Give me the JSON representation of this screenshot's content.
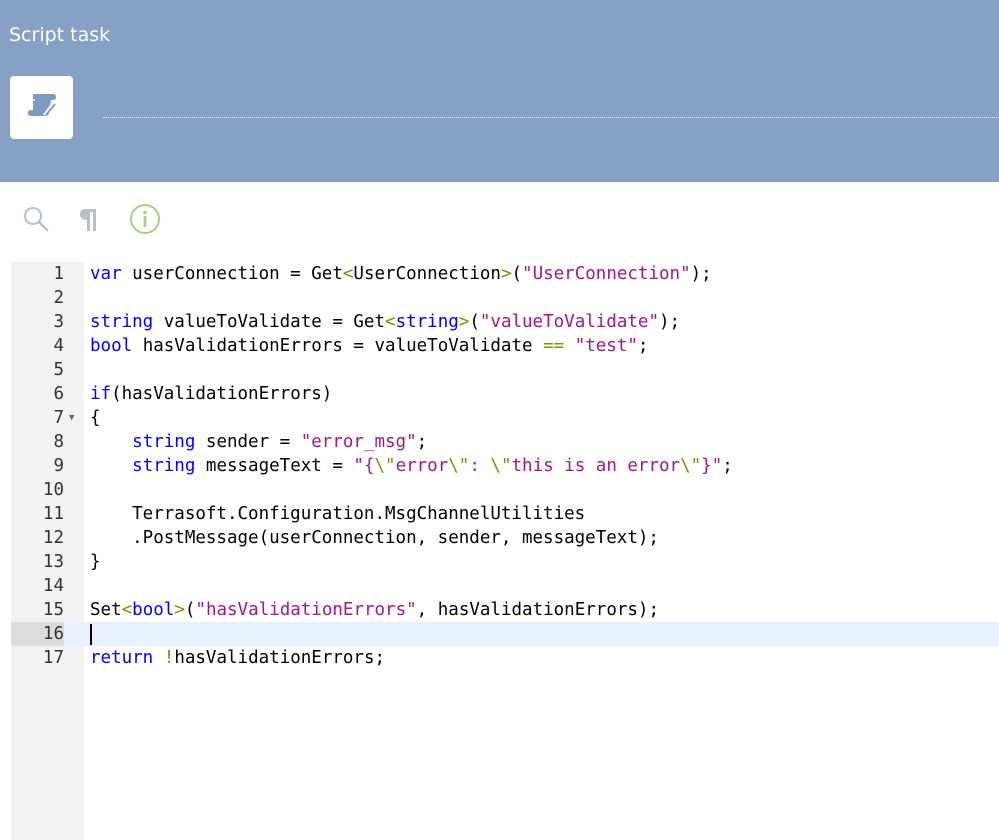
{
  "header": {
    "title": "Script task",
    "icon": "script-scroll-icon"
  },
  "toolbar": {
    "icons": [
      "search-icon",
      "paragraph-icon",
      "info-icon"
    ]
  },
  "editor": {
    "active_line": 16,
    "lines": [
      [
        [
          "p",
          "var"
        ],
        [
          " ",
          ""
        ],
        [
          "n",
          " userConnection = Get"
        ],
        [
          "o",
          "<"
        ],
        [
          "n",
          "UserConnection"
        ],
        [
          "o",
          ">"
        ],
        [
          "n",
          "("
        ],
        [
          "s",
          "\"UserConnection\""
        ],
        [
          "n",
          ");"
        ]
      ],
      [],
      [
        [
          "p",
          "string"
        ],
        [
          "n",
          " valueToValidate = Get"
        ],
        [
          "o",
          "<"
        ],
        [
          "p",
          "string"
        ],
        [
          "o",
          ">"
        ],
        [
          "n",
          "("
        ],
        [
          "s",
          "\"valueToValidate\""
        ],
        [
          "n",
          ");"
        ]
      ],
      [
        [
          "p",
          "bool"
        ],
        [
          "n",
          " hasValidationErrors = valueToValidate "
        ],
        [
          "o",
          "=="
        ],
        [
          "n",
          " "
        ],
        [
          "s",
          "\"test\""
        ],
        [
          "n",
          ";"
        ]
      ],
      [],
      [
        [
          "p",
          "if"
        ],
        [
          "n",
          "(hasValidationErrors)"
        ]
      ],
      [
        [
          "n",
          "{"
        ]
      ],
      [
        [
          "n",
          "    "
        ],
        [
          "p",
          "string"
        ],
        [
          "n",
          " sender = "
        ],
        [
          "s",
          "\"error_msg\""
        ],
        [
          "n",
          ";"
        ]
      ],
      [
        [
          "n",
          "    "
        ],
        [
          "p",
          "string"
        ],
        [
          "n",
          " messageText = "
        ],
        [
          "s",
          "\"{"
        ],
        [
          "o",
          "\\\""
        ],
        [
          "s",
          "error"
        ],
        [
          "o",
          "\\\""
        ],
        [
          "s",
          ": "
        ],
        [
          "o",
          "\\\""
        ],
        [
          "s",
          "this is an error"
        ],
        [
          "o",
          "\\\""
        ],
        [
          "s",
          "}\""
        ],
        [
          "n",
          ";"
        ]
      ],
      [],
      [
        [
          "n",
          "    Terrasoft.Configuration.MsgChannelUtilities"
        ]
      ],
      [
        [
          "n",
          "    .PostMessage(userConnection, sender, messageText);"
        ]
      ],
      [
        [
          "n",
          "}"
        ]
      ],
      [],
      [
        [
          "n",
          "Set"
        ],
        [
          "o",
          "<"
        ],
        [
          "p",
          "bool"
        ],
        [
          "o",
          ">"
        ],
        [
          "n",
          "("
        ],
        [
          "s",
          "\"hasValidationErrors\""
        ],
        [
          "n",
          ", hasValidationErrors);"
        ]
      ],
      [],
      [
        [
          "p",
          "return"
        ],
        [
          "n",
          " "
        ],
        [
          "o",
          "!"
        ],
        [
          "n",
          "hasValidationErrors;"
        ]
      ]
    ]
  }
}
